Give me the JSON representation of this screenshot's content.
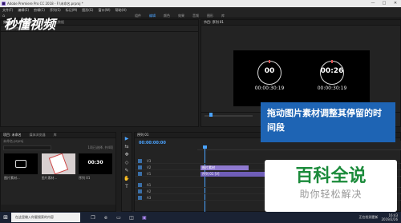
{
  "window": {
    "title": "Adobe Premiere Pro CC 2018 - F:\\未命名.prproj *",
    "controls": [
      "—",
      "□",
      "✕"
    ]
  },
  "menubar": {
    "items": [
      "文件(F)",
      "编辑(E)",
      "剪辑(C)",
      "序列(S)",
      "标记(M)",
      "图形(G)",
      "窗口(W)",
      "帮助(H)"
    ]
  },
  "workspaces": {
    "tabs": [
      "组件",
      "编辑",
      "颜色",
      "效果",
      "音频",
      "图形",
      "库"
    ],
    "active_index": 1
  },
  "source_panel": {
    "tabs": [
      "效果控件",
      "音频剪辑混合器",
      "元数据"
    ],
    "subheader": "（未选择剪辑）"
  },
  "program_panel": {
    "title": "节目: 序列 01",
    "clock_left": {
      "digits": "00",
      "sub": "00:00:30:19"
    },
    "clock_right": {
      "digits": "00:26",
      "sub": "00:00:30:19"
    }
  },
  "project_panel": {
    "tabs": [
      "项目: 未命名",
      "媒体浏览器",
      "库"
    ],
    "subheader": "未命名.prproj",
    "count": "1项已选择, 共4项",
    "items": [
      {
        "label": "图片素材..."
      },
      {
        "label": "图片素材..."
      },
      {
        "label": "序列 01",
        "digits": "00:30"
      }
    ]
  },
  "tools": {
    "items": [
      "▶",
      "⇆",
      "✥",
      "◇",
      "✎",
      "✋",
      "T"
    ]
  },
  "timeline_panel": {
    "tab": "序列 01",
    "timecode": "00:00:00:00",
    "tracks": [
      {
        "name": "V3",
        "clip": ""
      },
      {
        "name": "V2",
        "clip": "图片素材"
      },
      {
        "name": "V1",
        "clip": "序列 01 [V]"
      },
      {
        "name": "A1",
        "clip": ""
      },
      {
        "name": "A2",
        "clip": ""
      },
      {
        "name": "A3",
        "clip": ""
      }
    ]
  },
  "taskbar": {
    "search_placeholder": "在这里输入你要搜索的内容",
    "time": "16:43",
    "date": "2019/2/26",
    "tray_text": "正在检测更新"
  },
  "caption": {
    "text": "拖动图片素材调整其停留的时间段"
  },
  "watermarks": {
    "top_left": "秒懂视频",
    "bottom_right_title": "百科全说",
    "bottom_right_sub": "助你轻松解决"
  },
  "colors": {
    "accent": "#4aa3ff",
    "caption_bg": "#1e64b4",
    "clip": "#6f5eb8"
  }
}
